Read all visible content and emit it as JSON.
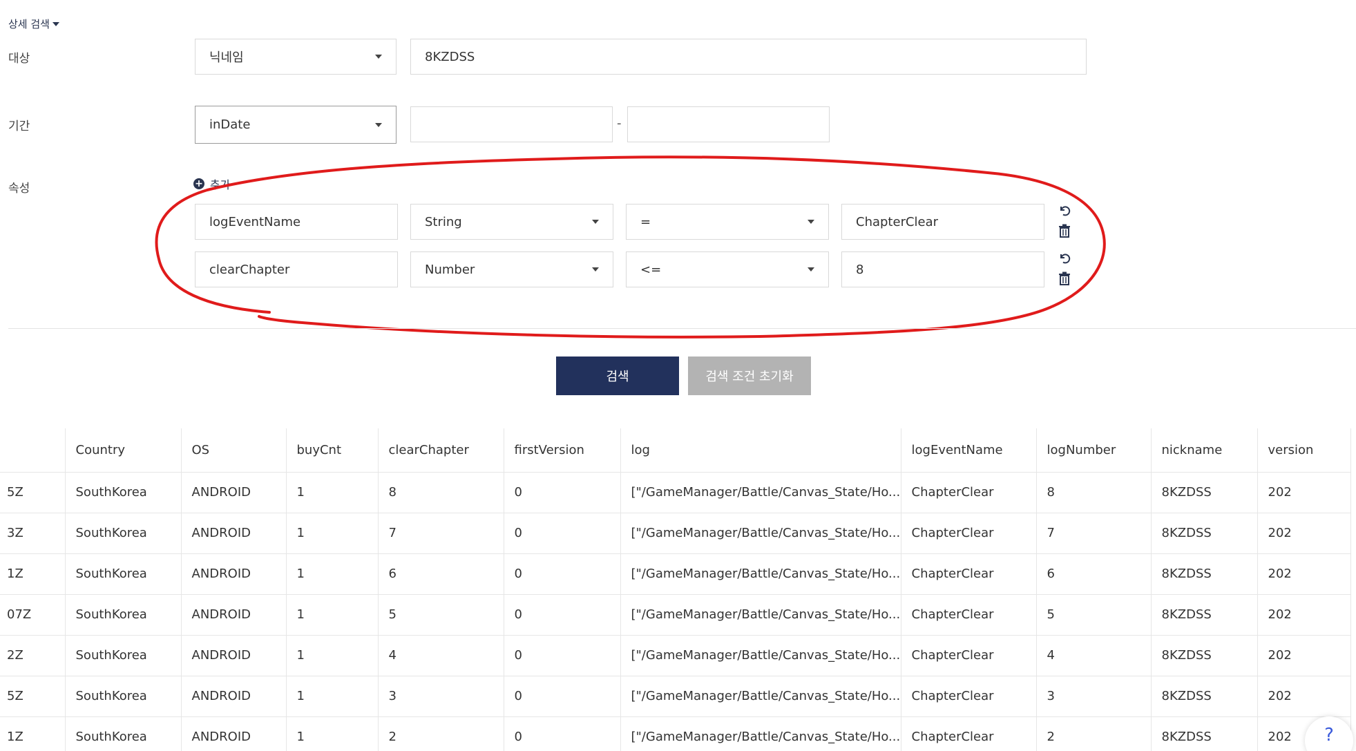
{
  "search": {
    "toggle_label": "상세 검색",
    "target_label": "대상",
    "target_select": "닉네임",
    "target_value": "8KZDSS",
    "period_label": "기간",
    "period_select": "inDate",
    "period_from": "",
    "period_to": "",
    "period_sep": "-",
    "attr_label": "속성",
    "add_label": "추가",
    "attributes": [
      {
        "name": "logEventName",
        "type": "String",
        "op": "=",
        "value": "ChapterClear"
      },
      {
        "name": "clearChapter",
        "type": "Number",
        "op": "<=",
        "value": "8"
      }
    ],
    "search_button": "검색",
    "reset_button": "검색 조건 초기화"
  },
  "table": {
    "headers": [
      "",
      "Country",
      "OS",
      "buyCnt",
      "clearChapter",
      "firstVersion",
      "log",
      "logEventName",
      "logNumber",
      "nickname",
      "version"
    ],
    "rows": [
      [
        "5Z",
        "SouthKorea",
        "ANDROID",
        "1",
        "8",
        "0",
        "[\"/GameManager/Battle/Canvas_State/Ho...",
        "ChapterClear",
        "8",
        "8KZDSS",
        "202"
      ],
      [
        "3Z",
        "SouthKorea",
        "ANDROID",
        "1",
        "7",
        "0",
        "[\"/GameManager/Battle/Canvas_State/Ho...",
        "ChapterClear",
        "7",
        "8KZDSS",
        "202"
      ],
      [
        "1Z",
        "SouthKorea",
        "ANDROID",
        "1",
        "6",
        "0",
        "[\"/GameManager/Battle/Canvas_State/Ho...",
        "ChapterClear",
        "6",
        "8KZDSS",
        "202"
      ],
      [
        "07Z",
        "SouthKorea",
        "ANDROID",
        "1",
        "5",
        "0",
        "[\"/GameManager/Battle/Canvas_State/Ho...",
        "ChapterClear",
        "5",
        "8KZDSS",
        "202"
      ],
      [
        "2Z",
        "SouthKorea",
        "ANDROID",
        "1",
        "4",
        "0",
        "[\"/GameManager/Battle/Canvas_State/Ho...",
        "ChapterClear",
        "4",
        "8KZDSS",
        "202"
      ],
      [
        "5Z",
        "SouthKorea",
        "ANDROID",
        "1",
        "3",
        "0",
        "[\"/GameManager/Battle/Canvas_State/Ho...",
        "ChapterClear",
        "3",
        "8KZDSS",
        "202"
      ],
      [
        "1Z",
        "SouthKorea",
        "ANDROID",
        "1",
        "2",
        "0",
        "[\"/GameManager/Battle/Canvas_State/Ho...",
        "ChapterClear",
        "2",
        "8KZDSS",
        "202"
      ]
    ]
  },
  "help_label": "?",
  "colors": {
    "primary": "#22315c",
    "secondary": "#b3b3b3",
    "annotation": "#e01b1b"
  },
  "icons": {
    "undo": "undo-icon",
    "trash": "trash-icon",
    "add": "plus-circle-icon",
    "caret": "chevron-down-icon"
  }
}
